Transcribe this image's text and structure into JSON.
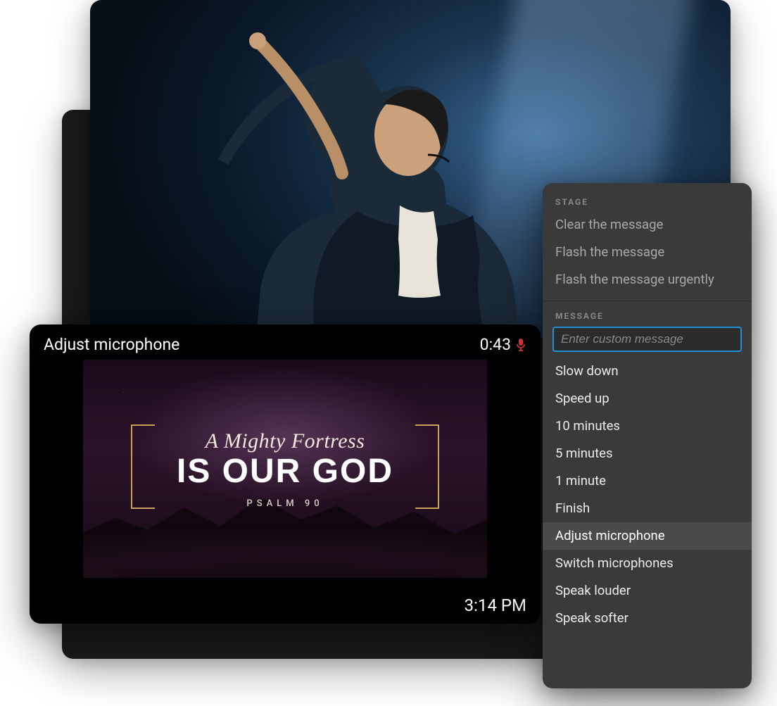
{
  "stage_monitor": {
    "status_message": "Adjust microphone",
    "timer": "0:43",
    "mic_icon_color": "#d83a3a",
    "slide": {
      "script_line": "A Mighty Fortress",
      "title": "IS OUR GOD",
      "subtitle": "PSALM 90",
      "bracket_color": "#c9a05a"
    },
    "clock": "3:14 PM"
  },
  "panel": {
    "stage_label": "STAGE",
    "stage_actions": [
      "Clear the message",
      "Flash the message",
      "Flash the message urgently"
    ],
    "message_label": "MESSAGE",
    "input_placeholder": "Enter custom message",
    "messages": [
      "Slow down",
      "Speed up",
      "10 minutes",
      "5 minutes",
      "1 minute",
      "Finish",
      "Adjust microphone",
      "Switch microphones",
      "Speak louder",
      "Speak softer"
    ],
    "selected_message": "Adjust microphone"
  }
}
